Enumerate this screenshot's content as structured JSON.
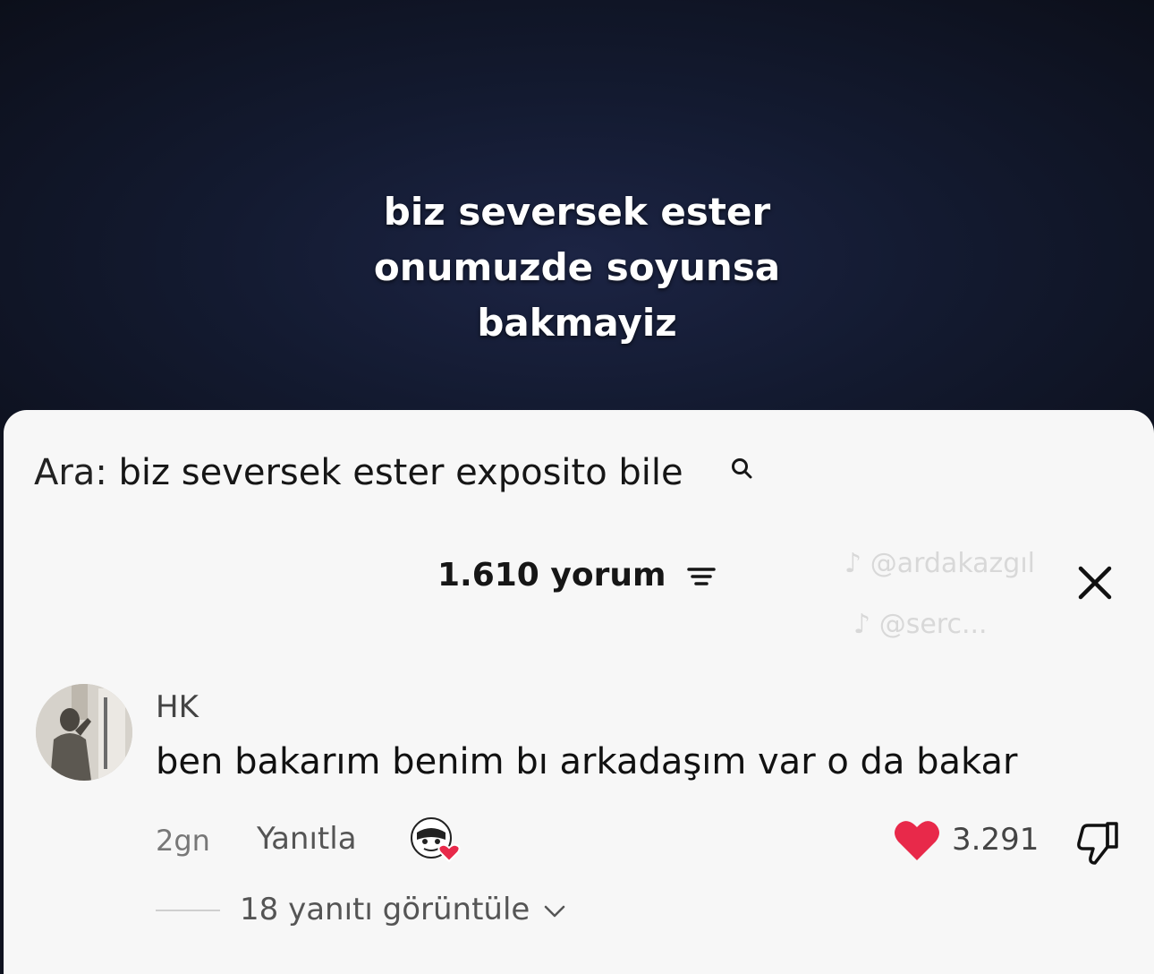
{
  "video": {
    "caption_lines": [
      "biz seversek ester",
      "onumuzde soyunsa",
      "bakmayiz"
    ]
  },
  "search": {
    "prefix": "Ara:",
    "query": "biz seversek ester exposito bile",
    "icon": "search-icon"
  },
  "comments_header": {
    "count_label": "1.610 yorum",
    "filter_icon": "filter-icon",
    "close_icon": "close-icon"
  },
  "watermarks": [
    "@ardakazgıl",
    "@serc..."
  ],
  "comment": {
    "username": "HK",
    "text": "ben bakarım benim bı arkadaşım var o da bakar",
    "time": "2gn",
    "reply_label": "Yanıtla",
    "likes": "3.291",
    "view_replies": "18 yanıtı görüntüle"
  },
  "colors": {
    "heart": "#e8294a",
    "sheet_bg": "#f7f7f7",
    "video_bg": "#131a30"
  }
}
